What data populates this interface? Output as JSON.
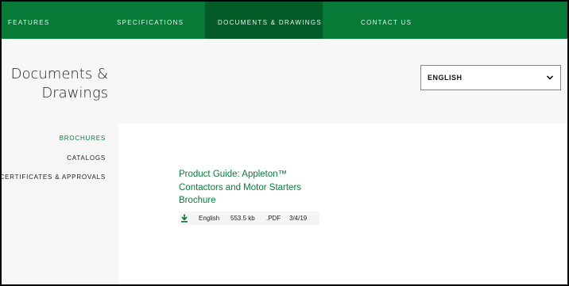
{
  "nav": {
    "features": "FEATURES",
    "specifications": "SPECIFICATIONS",
    "documents": "DOCUMENTS & DRAWINGS",
    "contact": "CONTACT US"
  },
  "header": {
    "title_line1": "Documents &",
    "title_line2": "Drawings",
    "language": "ENGLISH"
  },
  "sidebar": {
    "items": [
      {
        "label": "BROCHURES"
      },
      {
        "label": "CATALOGS"
      },
      {
        "label": "CERTIFICATES & APPROVALS"
      }
    ]
  },
  "document": {
    "title": "Product Guide: Appleton™ Contactors and Motor Starters Brochure",
    "language": "English",
    "size": "553.5 kb",
    "type": ".PDF",
    "date": "3/4/19"
  },
  "colors": {
    "brand_green": "#077a37",
    "active_tab": "#045d29"
  }
}
